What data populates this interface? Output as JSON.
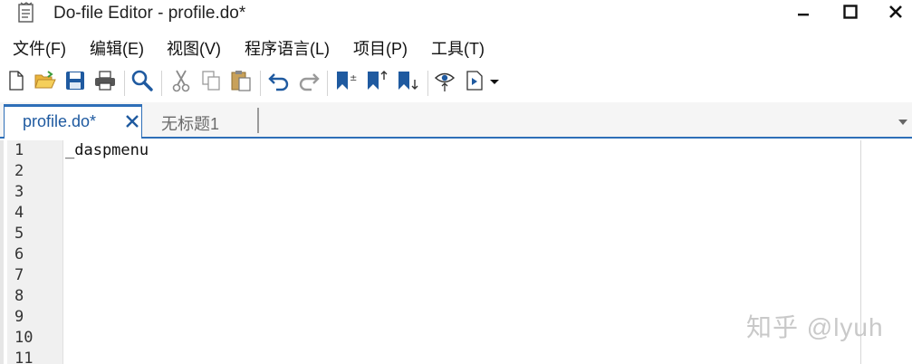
{
  "window": {
    "title": "Do-file Editor - profile.do*"
  },
  "menu": {
    "items": [
      "文件(F)",
      "编辑(E)",
      "视图(V)",
      "程序语言(L)",
      "项目(P)",
      "工具(T)"
    ]
  },
  "toolbar": {
    "icons": [
      "new-file-icon",
      "open-folder-icon",
      "save-icon",
      "print-icon",
      "find-icon",
      "cut-icon",
      "copy-icon",
      "paste-icon",
      "undo-icon",
      "redo-icon",
      "toggle-bookmark-icon",
      "previous-bookmark-icon",
      "next-bookmark-icon",
      "show-whitespace-icon",
      "execute-icon"
    ]
  },
  "tabs": {
    "active_label": "profile.do*",
    "inactive_label": "无标题1"
  },
  "editor": {
    "line_numbers": [
      "1",
      "2",
      "3",
      "4",
      "5",
      "6",
      "7",
      "8",
      "9",
      "10",
      "11"
    ],
    "lines": [
      "_daspmenu"
    ]
  },
  "watermark": "知乎 @lyuh",
  "colors": {
    "accent": "#2e6fb8",
    "gutter": "#f0f0f0"
  }
}
